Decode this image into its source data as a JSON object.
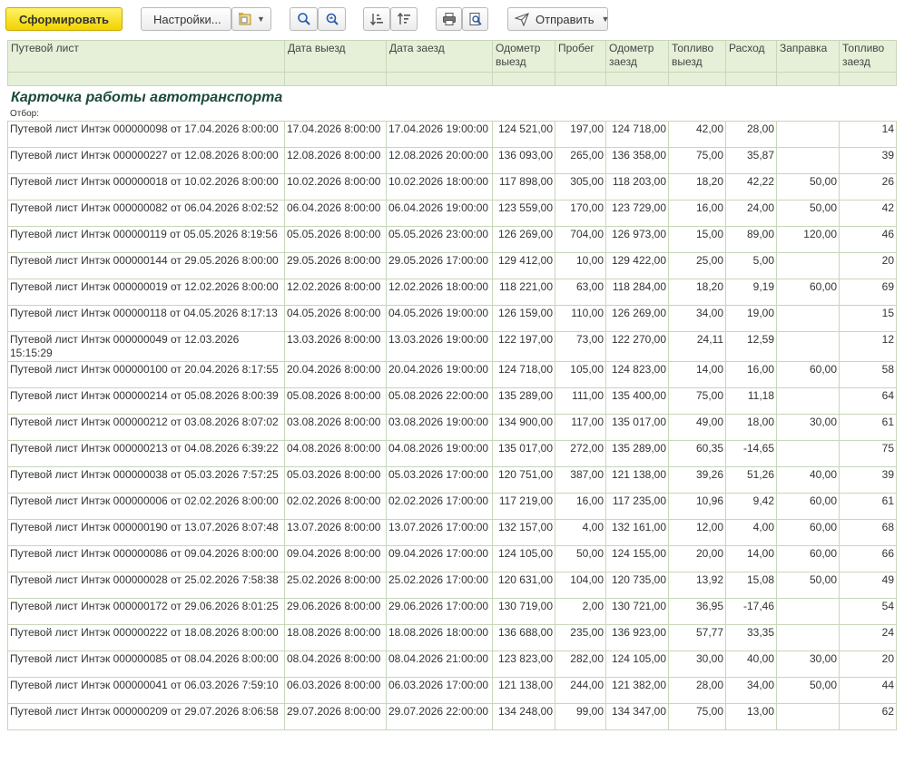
{
  "toolbar": {
    "generate_label": "Сформировать",
    "settings_label": "Настройки...",
    "send_label": "Отправить"
  },
  "report": {
    "title": "Карточка работы автотранспорта",
    "filter_label": "Отбор:",
    "columns": [
      "Путевой лист",
      "Дата выезд",
      "Дата заезд",
      "Одометр выезд",
      "Пробег",
      "Одометр заезд",
      "Топливо выезд",
      "Расход",
      "Заправка",
      "Топливо заезд"
    ],
    "rows": [
      [
        "Путевой лист Интэк 000000098 от 17.04.2026 8:00:00",
        "17.04.2026 8:00:00",
        "17.04.2026 19:00:00",
        "124 521,00",
        "197,00",
        "124 718,00",
        "42,00",
        "28,00",
        "",
        "14"
      ],
      [
        "Путевой лист Интэк 000000227 от 12.08.2026 8:00:00",
        "12.08.2026 8:00:00",
        "12.08.2026 20:00:00",
        "136 093,00",
        "265,00",
        "136 358,00",
        "75,00",
        "35,87",
        "",
        "39"
      ],
      [
        "Путевой лист Интэк 000000018 от 10.02.2026 8:00:00",
        "10.02.2026 8:00:00",
        "10.02.2026 18:00:00",
        "117 898,00",
        "305,00",
        "118 203,00",
        "18,20",
        "42,22",
        "50,00",
        "26"
      ],
      [
        "Путевой лист Интэк 000000082 от 06.04.2026 8:02:52",
        "06.04.2026 8:00:00",
        "06.04.2026 19:00:00",
        "123 559,00",
        "170,00",
        "123 729,00",
        "16,00",
        "24,00",
        "50,00",
        "42"
      ],
      [
        "Путевой лист Интэк 000000119 от 05.05.2026 8:19:56",
        "05.05.2026 8:00:00",
        "05.05.2026 23:00:00",
        "126 269,00",
        "704,00",
        "126 973,00",
        "15,00",
        "89,00",
        "120,00",
        "46"
      ],
      [
        "Путевой лист Интэк 000000144 от 29.05.2026 8:00:00",
        "29.05.2026 8:00:00",
        "29.05.2026 17:00:00",
        "129 412,00",
        "10,00",
        "129 422,00",
        "25,00",
        "5,00",
        "",
        "20"
      ],
      [
        "Путевой лист Интэк 000000019 от 12.02.2026 8:00:00",
        "12.02.2026 8:00:00",
        "12.02.2026 18:00:00",
        "118 221,00",
        "63,00",
        "118 284,00",
        "18,20",
        "9,19",
        "60,00",
        "69"
      ],
      [
        "Путевой лист Интэк 000000118 от 04.05.2026 8:17:13",
        "04.05.2026 8:00:00",
        "04.05.2026 19:00:00",
        "126 159,00",
        "110,00",
        "126 269,00",
        "34,00",
        "19,00",
        "",
        "15"
      ],
      [
        "Путевой лист Интэк 000000049 от 12.03.2026 15:15:29",
        "13.03.2026 8:00:00",
        "13.03.2026 19:00:00",
        "122 197,00",
        "73,00",
        "122 270,00",
        "24,11",
        "12,59",
        "",
        "12"
      ],
      [
        "Путевой лист Интэк 000000100 от 20.04.2026 8:17:55",
        "20.04.2026 8:00:00",
        "20.04.2026 19:00:00",
        "124 718,00",
        "105,00",
        "124 823,00",
        "14,00",
        "16,00",
        "60,00",
        "58"
      ],
      [
        "Путевой лист Интэк 000000214 от 05.08.2026 8:00:39",
        "05.08.2026 8:00:00",
        "05.08.2026 22:00:00",
        "135 289,00",
        "111,00",
        "135 400,00",
        "75,00",
        "11,18",
        "",
        "64"
      ],
      [
        "Путевой лист Интэк 000000212 от 03.08.2026 8:07:02",
        "03.08.2026 8:00:00",
        "03.08.2026 19:00:00",
        "134 900,00",
        "117,00",
        "135 017,00",
        "49,00",
        "18,00",
        "30,00",
        "61"
      ],
      [
        "Путевой лист Интэк 000000213 от 04.08.2026 6:39:22",
        "04.08.2026 8:00:00",
        "04.08.2026 19:00:00",
        "135 017,00",
        "272,00",
        "135 289,00",
        "60,35",
        "-14,65",
        "",
        "75"
      ],
      [
        "Путевой лист Интэк 000000038 от 05.03.2026 7:57:25",
        "05.03.2026 8:00:00",
        "05.03.2026 17:00:00",
        "120 751,00",
        "387,00",
        "121 138,00",
        "39,26",
        "51,26",
        "40,00",
        "39"
      ],
      [
        "Путевой лист Интэк 000000006 от 02.02.2026 8:00:00",
        "02.02.2026 8:00:00",
        "02.02.2026 17:00:00",
        "117 219,00",
        "16,00",
        "117 235,00",
        "10,96",
        "9,42",
        "60,00",
        "61"
      ],
      [
        "Путевой лист Интэк 000000190 от 13.07.2026 8:07:48",
        "13.07.2026 8:00:00",
        "13.07.2026 17:00:00",
        "132 157,00",
        "4,00",
        "132 161,00",
        "12,00",
        "4,00",
        "60,00",
        "68"
      ],
      [
        "Путевой лист Интэк 000000086 от 09.04.2026 8:00:00",
        "09.04.2026 8:00:00",
        "09.04.2026 17:00:00",
        "124 105,00",
        "50,00",
        "124 155,00",
        "20,00",
        "14,00",
        "60,00",
        "66"
      ],
      [
        "Путевой лист Интэк 000000028 от 25.02.2026 7:58:38",
        "25.02.2026 8:00:00",
        "25.02.2026 17:00:00",
        "120 631,00",
        "104,00",
        "120 735,00",
        "13,92",
        "15,08",
        "50,00",
        "49"
      ],
      [
        "Путевой лист Интэк 000000172 от 29.06.2026 8:01:25",
        "29.06.2026 8:00:00",
        "29.06.2026 17:00:00",
        "130 719,00",
        "2,00",
        "130 721,00",
        "36,95",
        "-17,46",
        "",
        "54"
      ],
      [
        "Путевой лист Интэк 000000222 от 18.08.2026 8:00:00",
        "18.08.2026 8:00:00",
        "18.08.2026 18:00:00",
        "136 688,00",
        "235,00",
        "136 923,00",
        "57,77",
        "33,35",
        "",
        "24"
      ],
      [
        "Путевой лист Интэк 000000085 от 08.04.2026 8:00:00",
        "08.04.2026 8:00:00",
        "08.04.2026 21:00:00",
        "123 823,00",
        "282,00",
        "124 105,00",
        "30,00",
        "40,00",
        "30,00",
        "20"
      ],
      [
        "Путевой лист Интэк 000000041 от 06.03.2026 7:59:10",
        "06.03.2026 8:00:00",
        "06.03.2026 17:00:00",
        "121 138,00",
        "244,00",
        "121 382,00",
        "28,00",
        "34,00",
        "50,00",
        "44"
      ],
      [
        "Путевой лист Интэк 000000209 от 29.07.2026 8:06:58",
        "29.07.2026 8:00:00",
        "29.07.2026 22:00:00",
        "134 248,00",
        "99,00",
        "134 347,00",
        "75,00",
        "13,00",
        "",
        "62"
      ]
    ]
  }
}
